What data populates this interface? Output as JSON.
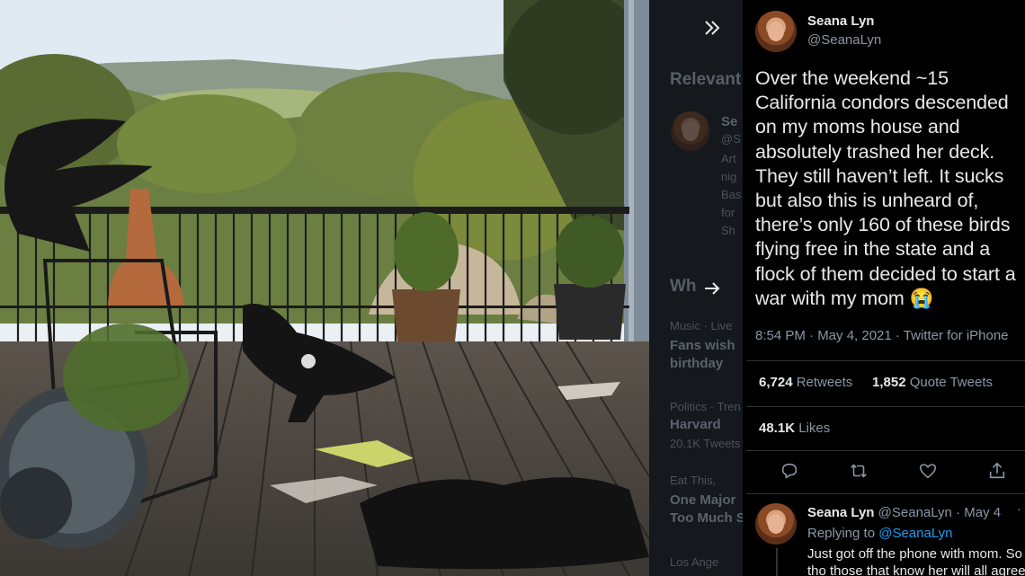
{
  "viewer": {
    "close_icon": "double-chevron-right",
    "next_icon": "arrow-right"
  },
  "background_column": {
    "heading": "Relevant",
    "lines": [
      "Se",
      "@S",
      "Art",
      "nig",
      "Bas",
      "for",
      "Sh"
    ],
    "whats_happening": "Wh",
    "trends": [
      {
        "context": "Music · Live",
        "title": "Fans wish",
        "subtitle": "birthday"
      },
      {
        "context": "Politics · Tren",
        "title": "Harvard",
        "subtitle": "20.1K Tweets"
      },
      {
        "context": "Eat This,",
        "title": "One Major",
        "subtitle": "Too Much S"
      },
      {
        "context": "Los Ange",
        "title": "",
        "subtitle": ""
      }
    ]
  },
  "tweet": {
    "author_name": "Seana Lyn",
    "author_handle": "@SeanaLyn",
    "text": "Over the weekend ~15 California condors descended on my moms house and absolutely trashed her deck. They still haven’t left. It sucks but also this is unheard of, there’s only 160 of these birds flying free in the state and a flock of them decided to start a war with my mom 😭",
    "time": "8:54 PM · May 4, 2021 · Twitter for iPhone",
    "retweets_count": "6,724",
    "retweets_label": "Retweets",
    "quote_count": "1,852",
    "quote_label": "Quote Tweets",
    "likes_count": "48.1K",
    "likes_label": "Likes",
    "actions": [
      "reply-icon",
      "retweet-icon",
      "like-icon",
      "share-icon"
    ]
  },
  "reply": {
    "author_name": "Seana Lyn",
    "author_handle": "@SeanaLyn",
    "date": "· May 4",
    "replying_prefix": "Replying to",
    "replying_handle": "@SeanaLyn",
    "line1": "Just got off the phone with mom. So",
    "line2": "tho those that know her will all agree"
  },
  "colors": {
    "panel_bg": "#000000",
    "text_primary": "#e7e9ea",
    "text_secondary": "#8b98a5",
    "link": "#1d9bf0",
    "divider": "#2f3336"
  }
}
